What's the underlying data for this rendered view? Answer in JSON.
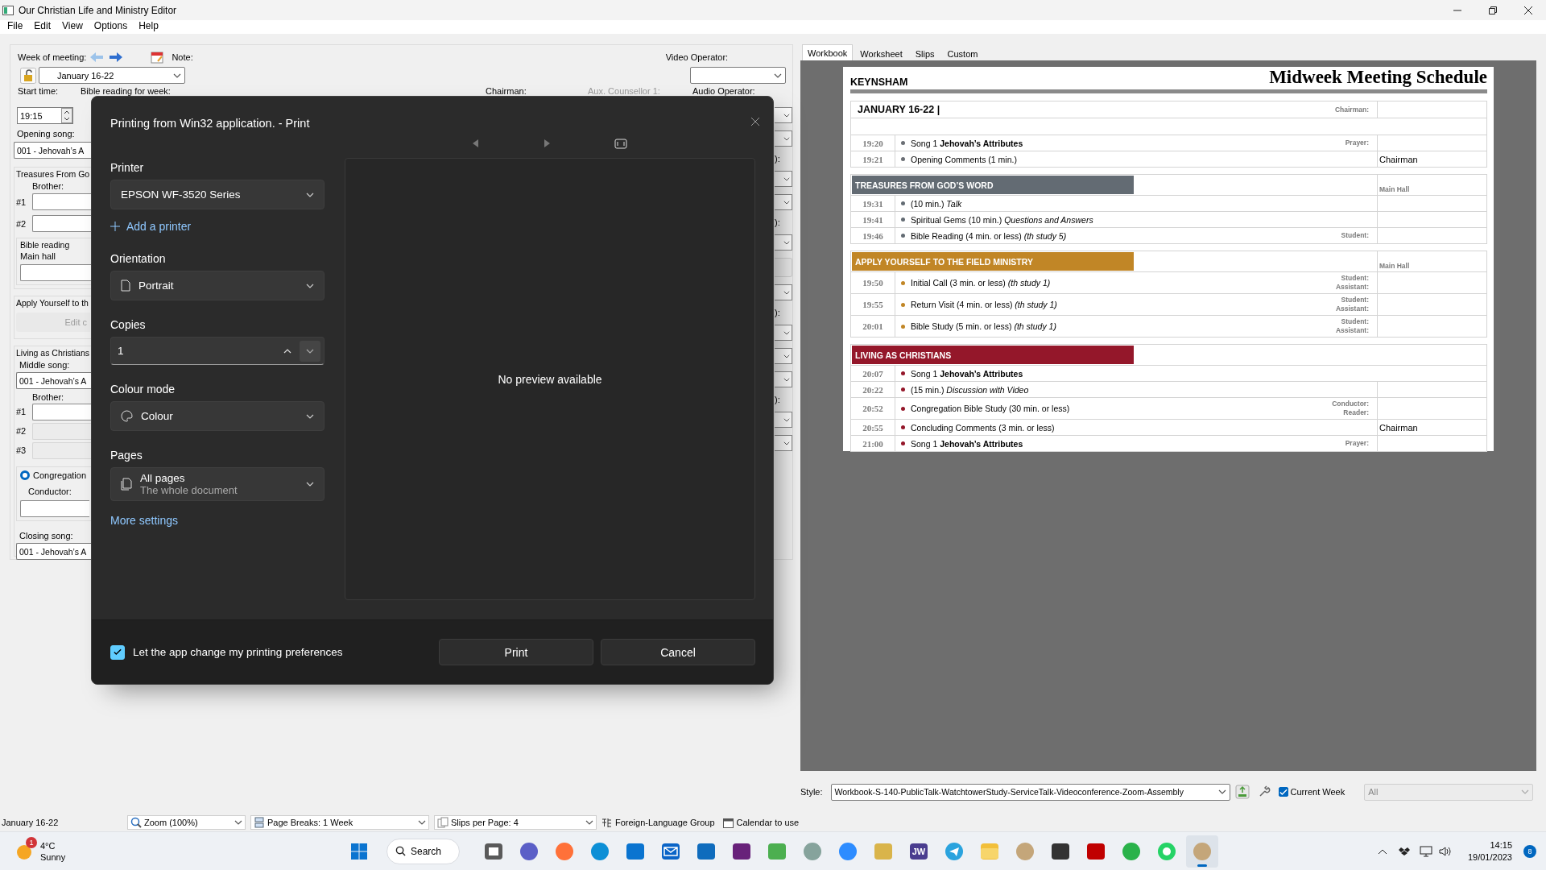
{
  "app": {
    "title": "Our Christian Life and Ministry Editor",
    "menu": [
      "File",
      "Edit",
      "View",
      "Options",
      "Help"
    ]
  },
  "editor": {
    "week_label": "Week of meeting:",
    "week": "January 16-22",
    "note_label": "Note:",
    "video_operator_label": "Video Operator:",
    "row_labels": [
      {
        "text": "Start time:",
        "disabled": false
      },
      {
        "text": "Bible reading for week:",
        "disabled": false
      },
      {
        "text": "Chairman:",
        "disabled": false
      },
      {
        "text": "Aux. Counsellor 1:",
        "disabled": true
      },
      {
        "text": "Audio Operator:",
        "disabled": false
      }
    ],
    "start_time": "19:15",
    "opening_song_label": "Opening song:",
    "opening_song": "001 - Jehovah’s A",
    "treasures": {
      "title": "Treasures From Go",
      "brother_label": "Brother:",
      "slots": [
        "#1",
        "#2"
      ],
      "reading_title": "Bible reading",
      "hall": "Main hall"
    },
    "apply": {
      "title": "Apply Yourself to th",
      "button": "Edit c"
    },
    "living": {
      "title": "Living as Christians",
      "middle_song_label": "Middle song:",
      "middle_song": "001 - Jehovah’s A",
      "brother_label": "Brother:",
      "slots": [
        {
          "label": "#1",
          "disabled": false
        },
        {
          "label": "#2",
          "disabled": true
        },
        {
          "label": "#3",
          "disabled": true
        }
      ],
      "study": {
        "label": "Congregation",
        "selected": true
      },
      "conductor_label": "Conductor:"
    },
    "closing_song_label": "Closing song:",
    "closing_song": "001 - Jehovah’s A",
    "edge": [
      {
        "kind": "combo"
      },
      {
        "kind": "combo"
      },
      {
        "kind": "label",
        "text": "):"
      },
      {
        "kind": "combo"
      },
      {
        "kind": "combo"
      },
      {
        "kind": "label",
        "text": "):"
      },
      {
        "kind": "combo"
      },
      {
        "kind": "button"
      },
      {
        "kind": "combo"
      },
      {
        "kind": "label",
        "text": "):"
      },
      {
        "kind": "combo"
      },
      {
        "kind": "combo"
      },
      {
        "kind": "combo"
      },
      {
        "kind": "label",
        "text": "):"
      },
      {
        "kind": "combo"
      },
      {
        "kind": "combo"
      }
    ]
  },
  "print_dialog": {
    "title": "Printing from Win32 application. - Print",
    "printer_label": "Printer",
    "printer": "EPSON WF-3520 Series",
    "add_printer": "Add a printer",
    "orientation_label": "Orientation",
    "orientation": "Portrait",
    "copies_label": "Copies",
    "copies": "1",
    "colour_label": "Colour mode",
    "colour": "Colour",
    "pages_label": "Pages",
    "pages": "All pages",
    "pages_hint": "The whole document",
    "more_settings": "More settings",
    "preview": "No preview available",
    "allow_prefs": {
      "label": "Let the app change my printing preferences",
      "checked": true
    },
    "buttons": [
      "Print",
      "Cancel"
    ]
  },
  "view_tabs": [
    {
      "label": "Workbook",
      "selected": true
    },
    {
      "label": "Worksheet",
      "selected": false
    },
    {
      "label": "Slips",
      "selected": false
    },
    {
      "label": "Custom",
      "selected": false
    }
  ],
  "schedule": {
    "congregation": "KEYNSHAM",
    "title": "Midweek Meeting Schedule",
    "date": "JANUARY 16-22 |",
    "date_label": "Chairman:",
    "sections": [
      {
        "kind": "plain",
        "color": "#6b6f75",
        "items": [
          {
            "time": "19:20",
            "text": "Song 1 **Jehovah’s Attributes**",
            "labels": [
              "Prayer:"
            ]
          },
          {
            "time": "19:21",
            "text": "Opening Comments  (1 min.)",
            "name": "Chairman"
          }
        ]
      },
      {
        "kind": "banner",
        "title": "TREASURES FROM GOD’S WORD",
        "side_label": "Main Hall",
        "color": "#636b73",
        "items": [
          {
            "time": "19:31",
            "text": " (10 min.) *Talk*"
          },
          {
            "time": "19:41",
            "text": "Spiritual Gems  (10 min.) *Questions and Answers*"
          },
          {
            "time": "19:46",
            "text": "Bible Reading  (4 min. or less) *(th study 5)*",
            "labels": [
              "Student:"
            ]
          }
        ]
      },
      {
        "kind": "banner",
        "title": "APPLY YOURSELF TO THE FIELD MINISTRY",
        "side_label": "Main Hall",
        "color": "#c18626",
        "items": [
          {
            "time": "19:50",
            "text": "Initial Call  (3 min. or less) *(th study 1)*",
            "labels": [
              "Student:",
              "Assistant:"
            ]
          },
          {
            "time": "19:55",
            "text": "Return Visit  (4 min. or less) *(th study 1)*",
            "labels": [
              "Student:",
              "Assistant:"
            ]
          },
          {
            "time": "20:01",
            "text": "Bible Study  (5 min. or less) *(th study 1)*",
            "labels": [
              "Student:",
              "Assistant:"
            ]
          }
        ]
      },
      {
        "kind": "banner",
        "title": "LIVING AS CHRISTIANS",
        "color": "#94172a",
        "items": [
          {
            "time": "20:07",
            "text": "Song 1 **Jehovah’s Attributes**",
            "wide": true
          },
          {
            "time": "20:22",
            "text": " (15 min.) *Discussion with Video*"
          },
          {
            "time": "20:52",
            "text": "Congregation Bible Study  (30 min. or less)",
            "labels": [
              "Conductor:",
              "Reader:"
            ]
          },
          {
            "time": "20:55",
            "text": "Concluding Comments  (3 min. or less)",
            "name": "Chairman"
          },
          {
            "time": "21:00",
            "text": "Song 1 **Jehovah’s Attributes**",
            "labels": [
              "Prayer:"
            ]
          }
        ]
      }
    ]
  },
  "style_bar": {
    "label": "Style:",
    "style": "Workbook-S-140-PublicTalk-WatchtowerStudy-ServiceTalk-Videoconference-Zoom-Assembly",
    "current_week": {
      "label": "Current Week",
      "checked": true
    },
    "filter": "All"
  },
  "status_bar": {
    "week": "January 16-22",
    "zoom": "Zoom (100%)",
    "page_breaks": "Page Breaks: 1 Week",
    "slips": "Slips per Page: 4",
    "foreign": "Foreign-Language Group",
    "calendar": "Calendar to use"
  },
  "taskbar": {
    "weather": {
      "badge": "1",
      "temp": "4°C",
      "condition": "Sunny"
    },
    "search": "Search",
    "apps": [
      {
        "kind": "taskview",
        "active": false
      },
      {
        "kind": "chat",
        "active": false
      },
      {
        "kind": "fox",
        "active": false
      },
      {
        "kind": "wave",
        "active": false
      },
      {
        "kind": "store",
        "active": false
      },
      {
        "kind": "mail",
        "active": false
      },
      {
        "kind": "outlook",
        "active": false
      },
      {
        "kind": "vs",
        "active": false
      },
      {
        "kind": "help",
        "active": false
      },
      {
        "kind": "globe",
        "active": false
      },
      {
        "kind": "video",
        "active": false
      },
      {
        "kind": "notes",
        "active": false
      },
      {
        "kind": "jw",
        "label": "JW",
        "active": false
      },
      {
        "kind": "plane",
        "active": false
      },
      {
        "kind": "folder",
        "active": false
      },
      {
        "kind": "ns",
        "active": false
      },
      {
        "kind": "camera",
        "active": false
      },
      {
        "kind": "fz",
        "active": false
      },
      {
        "kind": "two",
        "active": false
      },
      {
        "kind": "phone",
        "active": false
      },
      {
        "kind": "ns",
        "active": true
      }
    ],
    "clock": {
      "time": "14:15",
      "date": "19/01/2023",
      "badge": "8"
    }
  }
}
